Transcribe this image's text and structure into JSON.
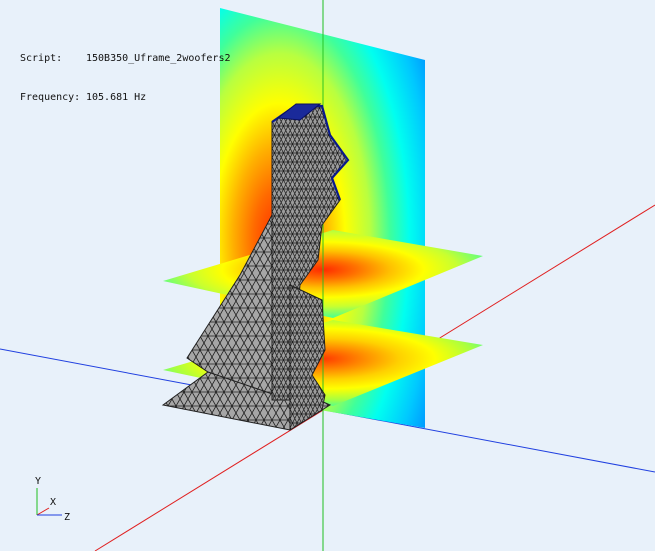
{
  "info": {
    "script_label": "Script:",
    "script_value": "150B350_Uframe_2woofers2",
    "frequency_label": "Frequency:",
    "frequency_value": "105.681 Hz"
  },
  "axes": {
    "y_label": "Y",
    "x_label": "X",
    "z_label": "Z",
    "colors": {
      "x_axis": "#e02020",
      "y_axis": "#20c020",
      "z_axis": "#2040e0"
    }
  },
  "colors": {
    "background": "#e8f1fa",
    "mesh_fill": "#a4a4a4",
    "mesh_edge": "#202020",
    "map_high": "#e03000",
    "map_mid": "#ffff00",
    "map_low": "#00c8ff"
  }
}
